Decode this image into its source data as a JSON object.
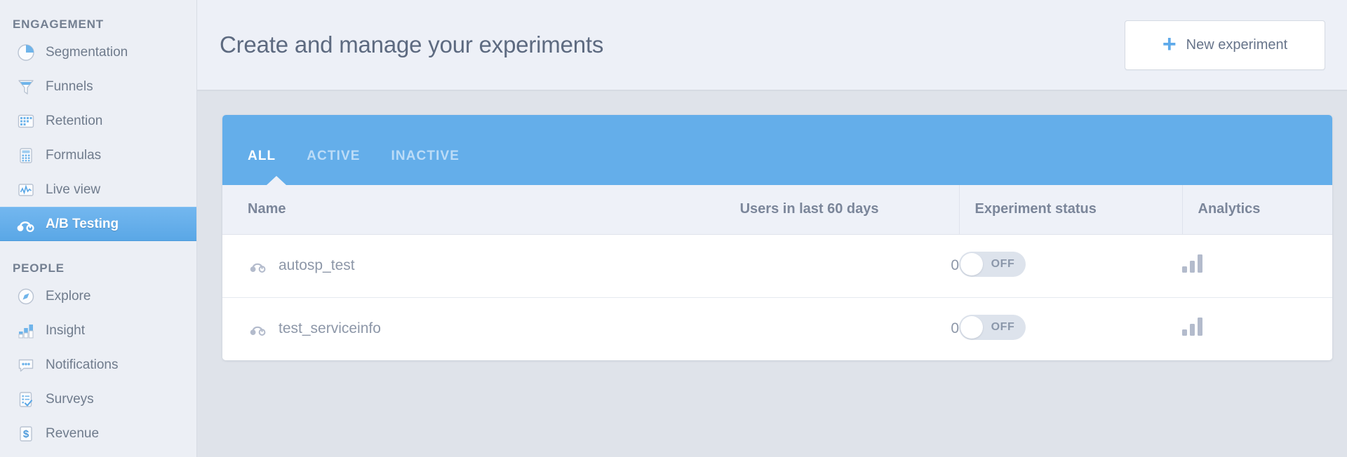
{
  "sidebar": {
    "groups": [
      {
        "title": "ENGAGEMENT",
        "items": [
          {
            "label": "Segmentation",
            "icon": "pie-chart-icon",
            "active": false
          },
          {
            "label": "Funnels",
            "icon": "funnel-icon",
            "active": false
          },
          {
            "label": "Retention",
            "icon": "grid-icon",
            "active": false
          },
          {
            "label": "Formulas",
            "icon": "calculator-icon",
            "active": false
          },
          {
            "label": "Live view",
            "icon": "live-chart-icon",
            "active": false
          },
          {
            "label": "A/B Testing",
            "icon": "ab-test-icon",
            "active": true
          }
        ]
      },
      {
        "title": "PEOPLE",
        "items": [
          {
            "label": "Explore",
            "icon": "compass-icon",
            "active": false
          },
          {
            "label": "Insight",
            "icon": "bar-chart-icon",
            "active": false
          },
          {
            "label": "Notifications",
            "icon": "speech-bubble-icon",
            "active": false
          },
          {
            "label": "Surveys",
            "icon": "clipboard-icon",
            "active": false
          },
          {
            "label": "Revenue",
            "icon": "dollar-icon",
            "active": false
          }
        ]
      }
    ]
  },
  "header": {
    "title": "Create and manage your experiments",
    "new_experiment_label": "New experiment",
    "new_experiment_plus": "+"
  },
  "tabs": [
    {
      "label": "ALL",
      "active": true
    },
    {
      "label": "ACTIVE",
      "active": false
    },
    {
      "label": "INACTIVE",
      "active": false
    }
  ],
  "table": {
    "columns": [
      "Name",
      "Users in last 60 days",
      "Experiment status",
      "Analytics"
    ],
    "rows": [
      {
        "name": "autosp_test",
        "users": "0",
        "status": "OFF",
        "status_on": false
      },
      {
        "name": "test_serviceinfo",
        "users": "0",
        "status": "OFF",
        "status_on": false
      }
    ]
  },
  "colors": {
    "accent_blue": "#64aeea",
    "sidebar_bg": "#eceff5",
    "page_bg": "#dfe3ea",
    "header_bg": "#edf0f7",
    "text_muted": "#8d97a8"
  }
}
